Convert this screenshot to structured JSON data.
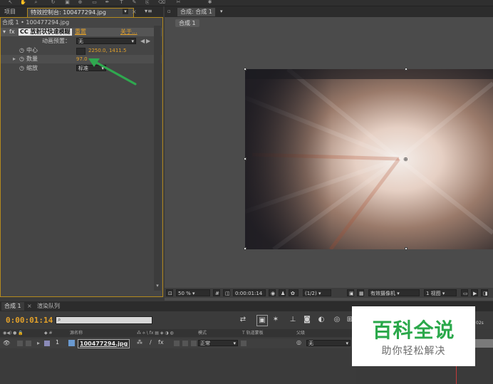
{
  "toolbar": {
    "icons": [
      "select-tool-icon",
      "hand-tool-icon",
      "zoom-tool-icon",
      "rotate-tool-icon",
      "camera-tool-icon",
      "pan-behind-tool-icon",
      "mask-tool-icon",
      "pen-tool-icon",
      "text-tool-icon",
      "brush-tool-icon",
      "clone-tool-icon",
      "eraser-tool-icon",
      "roto-tool-icon",
      "puppet-tool-icon"
    ]
  },
  "left_panel": {
    "tabs": [
      {
        "label": "项目"
      },
      {
        "label": "特效控制台: 100477294.jpg"
      }
    ],
    "menu_glyph": "▾≡",
    "breadcrumb": "合成 1 • 100477294.jpg",
    "effect": {
      "fx": "fx",
      "name": "CC 放射状快速模糊",
      "reset": "重置",
      "about": "关于..."
    },
    "preset": {
      "label": "动画预置：",
      "value": "无"
    },
    "props": [
      {
        "label": "中心",
        "value": "2250.0, 1411.5"
      },
      {
        "label": "数量",
        "value": "97.0"
      },
      {
        "label": "缩放",
        "value": "标准"
      }
    ]
  },
  "viewer": {
    "tabs": [
      {
        "label": "合成: 合成 1"
      }
    ],
    "crumb": "合成 1",
    "bottom": {
      "zoom": "50 %",
      "timecode": "0:00:01:14",
      "resolution": "(1/2)",
      "camera": "有效摄像机",
      "views": "1 视图"
    }
  },
  "timeline": {
    "tabs": [
      {
        "label": "合成 1"
      },
      {
        "label": "渲染队列"
      }
    ],
    "timecode": "0:00:01:14",
    "search_placeholder": "",
    "columns": {
      "source": "源名称",
      "mode": "模式",
      "trkmat": "T  轨道蒙板",
      "parent": "父级"
    },
    "layer": {
      "num": "1",
      "name": "100477294.jpg",
      "mode": "正常",
      "parent": "无"
    },
    "ruler_mark": "02s"
  },
  "watermark": {
    "title": "百科全说",
    "subtitle": "助你轻松解决"
  },
  "colors": {
    "accent": "#e3a12a",
    "panel_border": "#b48a1e",
    "arrow": "#2fa84f",
    "watermark_green": "#2aa84a"
  }
}
